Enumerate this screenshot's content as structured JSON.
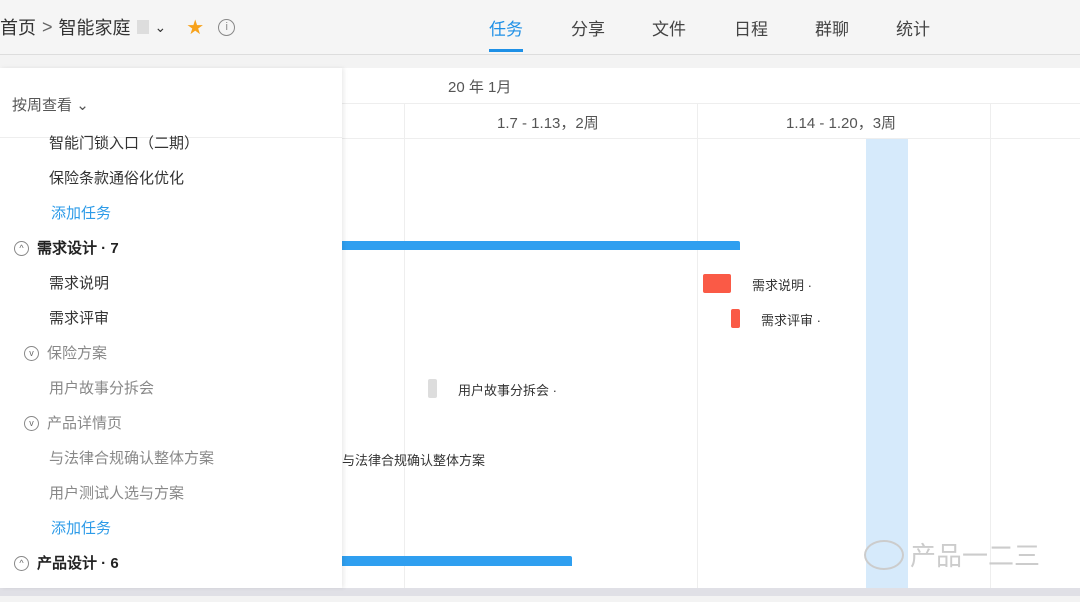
{
  "header": {
    "home": "首页",
    "separator": ">",
    "project": "智能家庭",
    "tabs": [
      "任务",
      "分享",
      "文件",
      "日程",
      "群聊",
      "统计"
    ],
    "active_tab": "任务"
  },
  "left": {
    "view_selector": "按周查看",
    "rows": [
      {
        "type": "task",
        "label": "智能门锁入口（二期）"
      },
      {
        "type": "task",
        "label": "保险条款通俗化优化"
      },
      {
        "type": "add",
        "label": "添加任务"
      },
      {
        "type": "group",
        "label": "需求设计 · 7"
      },
      {
        "type": "task",
        "label": "需求说明"
      },
      {
        "type": "task",
        "label": "需求评审"
      },
      {
        "type": "sub",
        "label": "保险方案"
      },
      {
        "type": "taskgray",
        "label": "用户故事分拆会"
      },
      {
        "type": "sub",
        "label": "产品详情页"
      },
      {
        "type": "taskgray",
        "label": "与法律合规确认整体方案"
      },
      {
        "type": "taskgray",
        "label": "用户测试人选与方案"
      },
      {
        "type": "add",
        "label": "添加任务"
      },
      {
        "type": "group",
        "label": "产品设计 · 6"
      }
    ]
  },
  "timeline": {
    "month": "20  年 1月",
    "weeks": [
      "1.7 - 1.13，2周",
      "1.14 - 1.20，3周"
    ],
    "labels": {
      "l1": "需求说明 ·",
      "l2": "需求评审 ·",
      "l3": "用户故事分拆会 ·",
      "l4": "与法律合规确认整体方案"
    }
  },
  "colors": {
    "accent": "#1e90e6",
    "bar_blue": "#2f9ff0",
    "bar_red": "#fa5a46",
    "today": "#d6eafb"
  },
  "watermark": "产品一二三"
}
